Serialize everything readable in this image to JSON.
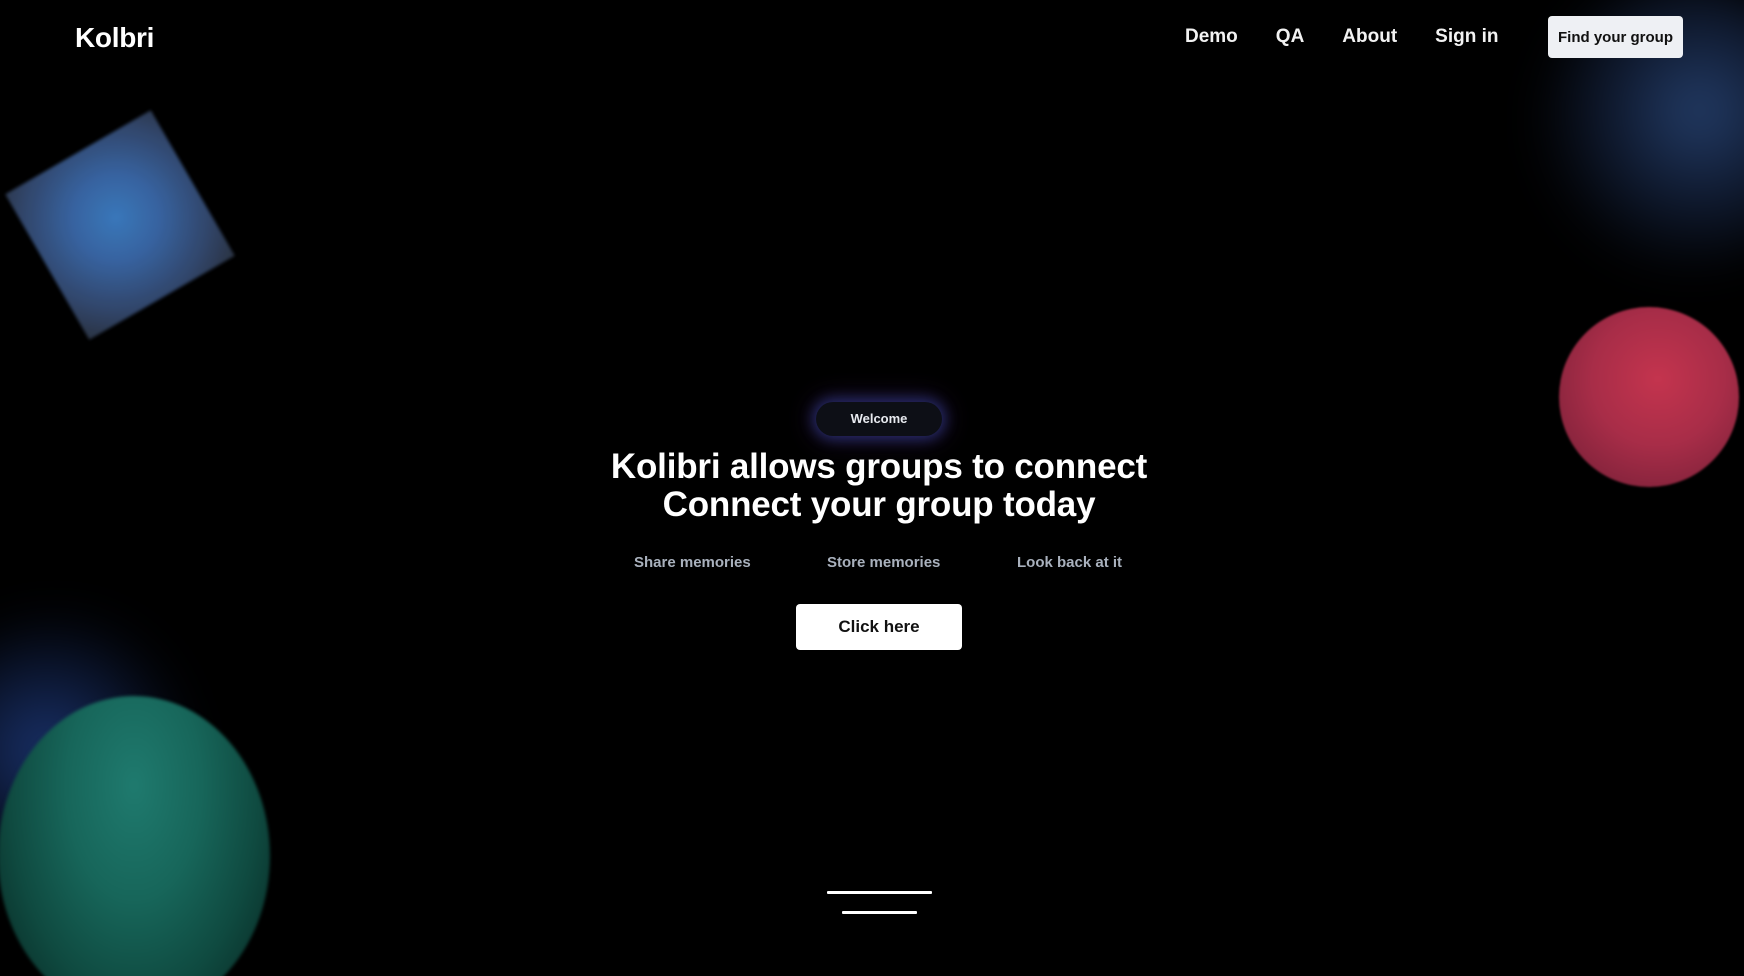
{
  "header": {
    "logo": "Kolbri",
    "nav": [
      {
        "label": "Demo"
      },
      {
        "label": "QA"
      },
      {
        "label": "About"
      },
      {
        "label": "Sign in"
      }
    ],
    "cta_label": "Find your group"
  },
  "hero": {
    "badge": "Welcome",
    "headline_line1": "Kolibri allows groups to connect",
    "headline_line2": "Connect your group today",
    "features": [
      "Share memories",
      "Store memories",
      "Look back at it"
    ],
    "cta_label": "Click here"
  },
  "decor": {
    "colors": {
      "background": "#000000",
      "square": "#3d7ec4",
      "red_circle": "#c4344e",
      "green_oval": "#1f7a6e",
      "blue_glow": "#30528c"
    }
  }
}
